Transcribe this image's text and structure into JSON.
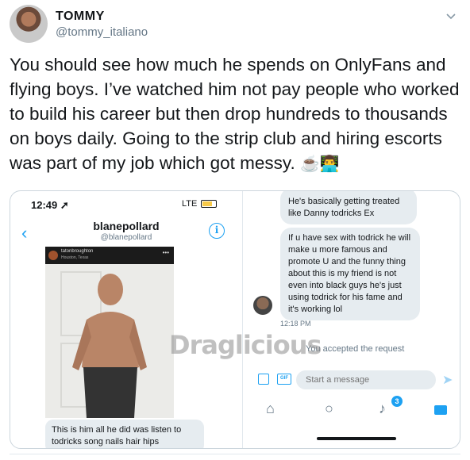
{
  "tweet": {
    "display_name": "TOMMY",
    "handle": "@tommy_italiano",
    "text": "You should see how much he spends on OnlyFans and flying boys. I’ve watched him not pay people who worked to build his career but then drop hundreds to thousands on boys daily. Going to the strip club and hiring escorts was part of my job which got messy.",
    "emojis": "☕👨‍💻"
  },
  "screenshot_left": {
    "status_time": "12:49 ➚",
    "status_right": "LTE",
    "profile_name": "blanepollard",
    "profile_handle": "@blanepollard",
    "photo_user": "tatonbroughton",
    "photo_location": "Houston, Texas",
    "caption": "This is him all he did was listen to todricks song nails hair hips"
  },
  "screenshot_right": {
    "bubble1": "He's basically getting treated like Danny todricks Ex",
    "bubble2": "If u have sex with todrick he will make u more famous and promote U and the funny thing about this is my friend is not even into black guys he's just using todrick for his fame and it's working lol",
    "timestamp": "12:18 PM",
    "accepted": "You accepted the request",
    "compose_placeholder": "Start a message",
    "gif_label": "GIF",
    "notification_count": "3"
  },
  "watermark": "Draglicious",
  "colors": {
    "accent": "#1da1f2",
    "bubble": "#e6ecf0",
    "muted": "#657786"
  }
}
